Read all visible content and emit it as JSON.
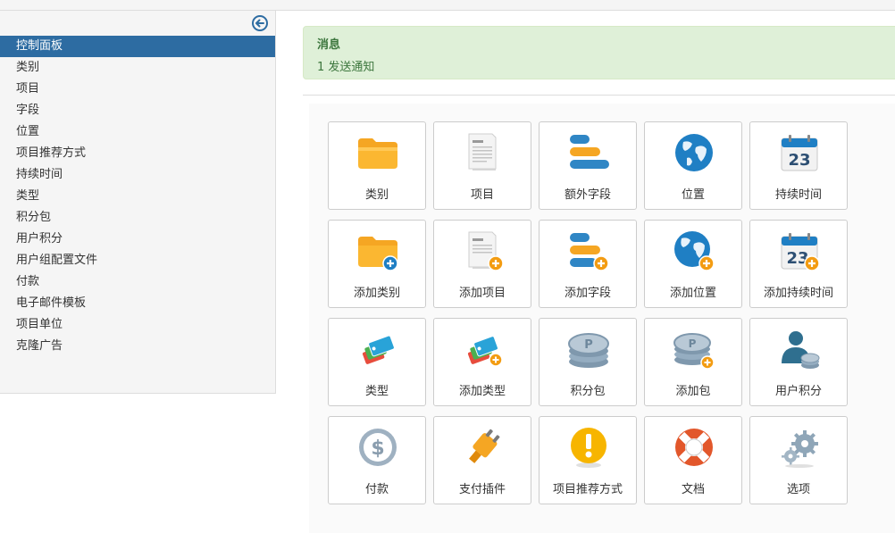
{
  "sidebar": {
    "items": [
      {
        "label": "控制面板",
        "active": true
      },
      {
        "label": "类别"
      },
      {
        "label": "项目"
      },
      {
        "label": "字段"
      },
      {
        "label": "位置"
      },
      {
        "label": "项目推荐方式"
      },
      {
        "label": "持续时间"
      },
      {
        "label": "类型"
      },
      {
        "label": "积分包"
      },
      {
        "label": "用户积分"
      },
      {
        "label": "用户组配置文件"
      },
      {
        "label": "付款"
      },
      {
        "label": "电子邮件模板"
      },
      {
        "label": "项目单位"
      },
      {
        "label": "克隆广告"
      }
    ]
  },
  "alert": {
    "title": "消息",
    "text": "1 发送通知"
  },
  "tiles": [
    {
      "label": "类别",
      "icon": "folder-icon"
    },
    {
      "label": "项目",
      "icon": "article-icon"
    },
    {
      "label": "额外字段",
      "icon": "fields-icon"
    },
    {
      "label": "位置",
      "icon": "globe-icon"
    },
    {
      "label": "持续时间",
      "icon": "calendar-icon"
    },
    {
      "label": "添加类别",
      "icon": "folder-add-icon"
    },
    {
      "label": "添加项目",
      "icon": "article-add-icon"
    },
    {
      "label": "添加字段",
      "icon": "fields-add-icon"
    },
    {
      "label": "添加位置",
      "icon": "globe-add-icon"
    },
    {
      "label": "添加持续时间",
      "icon": "calendar-add-icon"
    },
    {
      "label": "类型",
      "icon": "tags-icon"
    },
    {
      "label": "添加类型",
      "icon": "tags-add-icon"
    },
    {
      "label": "积分包",
      "icon": "coins-icon"
    },
    {
      "label": "添加包",
      "icon": "coins-add-icon"
    },
    {
      "label": "用户积分",
      "icon": "user-coins-icon"
    },
    {
      "label": "付款",
      "icon": "dollar-icon"
    },
    {
      "label": "支付插件",
      "icon": "plug-icon"
    },
    {
      "label": "项目推荐方式",
      "icon": "exclamation-icon"
    },
    {
      "label": "文档",
      "icon": "lifebuoy-icon"
    },
    {
      "label": "选项",
      "icon": "gears-icon"
    }
  ],
  "calendar_day": "23",
  "colors": {
    "accent": "#2d6ca2",
    "alert_bg": "#dff0d8",
    "alert_text": "#3c763d",
    "add_badge": "#f39c12"
  }
}
